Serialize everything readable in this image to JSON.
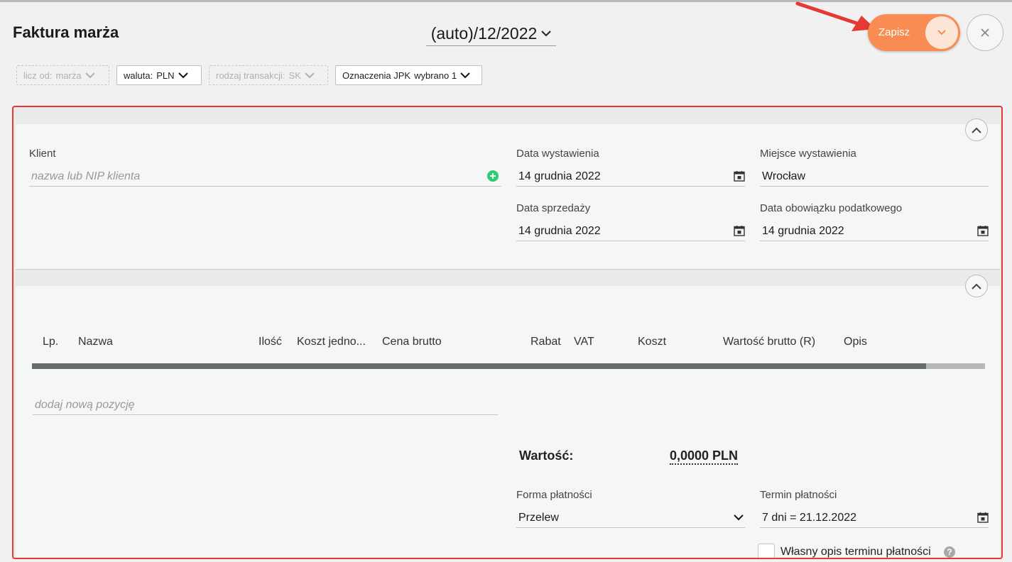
{
  "header": {
    "title": "Faktura marża",
    "doc_number": "(auto)/12/2022",
    "save_label": "Zapisz"
  },
  "filters": [
    {
      "label": "licz od:",
      "value": "marża"
    },
    {
      "label": "waluta:",
      "value": "PLN"
    },
    {
      "label": "rodzaj transakcji:",
      "value": "SK"
    },
    {
      "label": "Oznaczenia JPK",
      "value": "wybrano 1"
    }
  ],
  "client": {
    "label": "Klient",
    "placeholder": "nazwa lub NIP klienta"
  },
  "dates": {
    "issue_label": "Data wystawienia",
    "issue_value": "14 grudnia 2022",
    "place_label": "Miejsce wystawienia",
    "place_value": "Wrocław",
    "sale_label": "Data sprzedaży",
    "sale_value": "14 grudnia 2022",
    "tax_label": "Data obowiązku podatkowego",
    "tax_value": "14 grudnia 2022"
  },
  "table": {
    "columns": [
      "Lp.",
      "Nazwa",
      "Ilość",
      "Koszt jedno...",
      "Cena brutto",
      "Rabat",
      "VAT",
      "Koszt",
      "Wartość brutto (R)",
      "Opis"
    ],
    "add_item_placeholder": "dodaj nową pozycję"
  },
  "summary": {
    "total_label": "Wartość:",
    "total_value": "0,0000 PLN"
  },
  "payment": {
    "method_label": "Forma płatności",
    "method_value": "Przelew",
    "term_label": "Termin płatności",
    "term_value": "7 dni = 21.12.2022",
    "custom_desc_label": "Własny opis terminu płatności"
  },
  "colors": {
    "accent": "#f88c52",
    "annotation": "#e53935",
    "add_icon": "#2ecc71"
  },
  "icons": [
    "chevron-down-icon",
    "close-icon",
    "calendar-icon",
    "plus-circle-icon",
    "chevron-up-icon",
    "help-icon"
  ]
}
